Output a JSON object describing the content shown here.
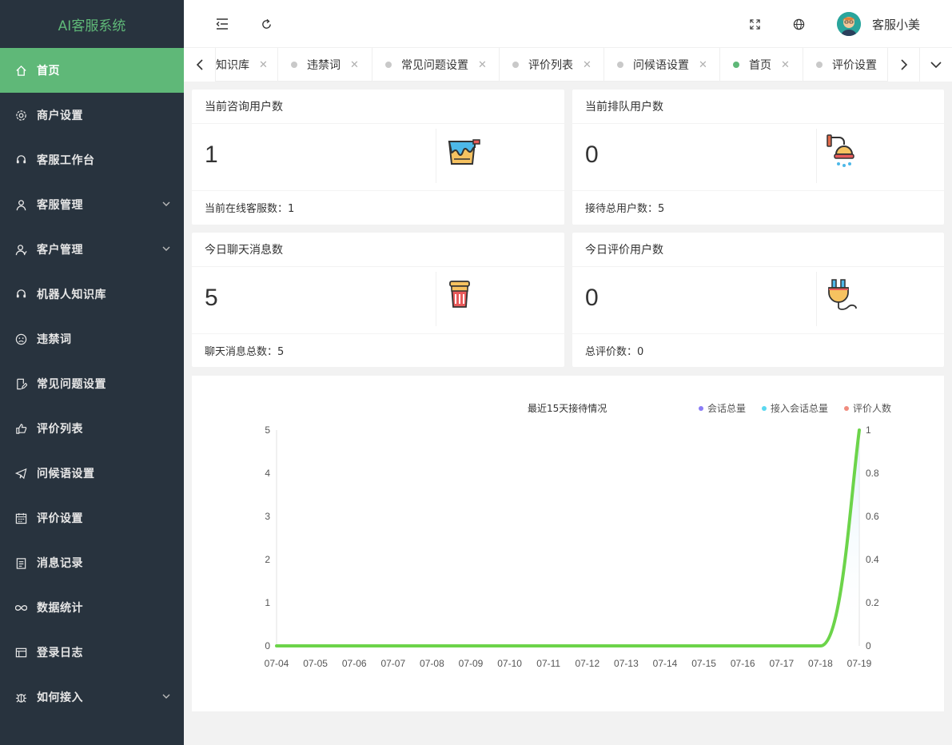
{
  "app": {
    "title": "AI客服系统"
  },
  "sidebar": {
    "items": [
      {
        "label": "首页",
        "icon": "home-icon",
        "active": true
      },
      {
        "label": "商户设置",
        "icon": "gear-icon"
      },
      {
        "label": "客服工作台",
        "icon": "headset-icon"
      },
      {
        "label": "客服管理",
        "icon": "user-icon",
        "expandable": true
      },
      {
        "label": "客户管理",
        "icon": "users-icon",
        "expandable": true
      },
      {
        "label": "机器人知识库",
        "icon": "headset-icon"
      },
      {
        "label": "违禁词",
        "icon": "frown-icon"
      },
      {
        "label": "常见问题设置",
        "icon": "edit-doc-icon"
      },
      {
        "label": "评价列表",
        "icon": "thumbs-up-icon"
      },
      {
        "label": "问候语设置",
        "icon": "send-icon"
      },
      {
        "label": "评价设置",
        "icon": "calendar-icon"
      },
      {
        "label": "消息记录",
        "icon": "clipboard-icon"
      },
      {
        "label": "数据统计",
        "icon": "infinity-icon"
      },
      {
        "label": "登录日志",
        "icon": "window-icon"
      },
      {
        "label": "如何接入",
        "icon": "bug-icon",
        "expandable": true
      }
    ]
  },
  "header": {
    "user_name": "客服小美"
  },
  "tabs": [
    {
      "label": "知识库"
    },
    {
      "label": "违禁词"
    },
    {
      "label": "常见问题设置"
    },
    {
      "label": "评价列表"
    },
    {
      "label": "问候语设置"
    },
    {
      "label": "首页",
      "active": true
    },
    {
      "label": "评价设置"
    }
  ],
  "stats": [
    {
      "title": "当前咨询用户数",
      "value": "1",
      "footer": "当前在线客服数：1",
      "icon": "paint-bucket-icon"
    },
    {
      "title": "当前排队用户数",
      "value": "0",
      "footer": "接待总用户数：5",
      "icon": "shower-icon"
    },
    {
      "title": "今日聊天消息数",
      "value": "5",
      "footer": "聊天消息总数：5",
      "icon": "trash-bin-icon"
    },
    {
      "title": "今日评价用户数",
      "value": "0",
      "footer": "总评价数：0",
      "icon": "power-plug-icon"
    }
  ],
  "colors": {
    "accent": "#5fb878",
    "sidebar": "#28333e"
  },
  "chart_data": {
    "type": "line",
    "title": "最近15天接待情况",
    "categories": [
      "07-04",
      "07-05",
      "07-06",
      "07-07",
      "07-08",
      "07-09",
      "07-10",
      "07-11",
      "07-12",
      "07-13",
      "07-14",
      "07-15",
      "07-16",
      "07-17",
      "07-18",
      "07-19"
    ],
    "series": [
      {
        "name": "会话总量",
        "color": "#8a7cf6",
        "values": [
          0,
          0,
          0,
          0,
          0,
          0,
          0,
          0,
          0,
          0,
          0,
          0,
          0,
          0,
          0,
          5
        ]
      },
      {
        "name": "接入会话总量",
        "color": "#5ad8f0",
        "values": [
          0,
          0,
          0,
          0,
          0,
          0,
          0,
          0,
          0,
          0,
          0,
          0,
          0,
          0,
          0,
          0
        ]
      },
      {
        "name": "评价人数",
        "color": "#f08c7e",
        "values": [
          0,
          0,
          0,
          0,
          0,
          0,
          0,
          0,
          0,
          0,
          0,
          0,
          0,
          0,
          0,
          0
        ]
      }
    ],
    "y_left": {
      "min": 0,
      "max": 5,
      "ticks": [
        "0",
        "1",
        "2",
        "3",
        "4",
        "5"
      ]
    },
    "y_right": {
      "min": 0,
      "max": 1,
      "ticks": [
        "0",
        "0.2",
        "0.4",
        "0.6",
        "0.8",
        "1"
      ]
    },
    "legend_position": "top-right",
    "grid": false
  }
}
